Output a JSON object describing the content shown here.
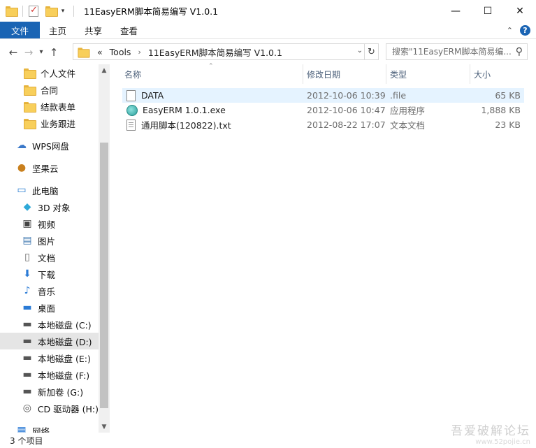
{
  "window": {
    "title": "11EasyERM脚本简易编写 V1.0.1",
    "minimize": "—",
    "maximize": "☐",
    "close": "✕"
  },
  "ribbon": {
    "tabs": [
      "文件",
      "主页",
      "共享",
      "查看"
    ],
    "collapse_icon": "chevron-up-icon",
    "help": "?"
  },
  "address": {
    "overflow": "«",
    "crumbs": [
      "Tools",
      "11EasyERM脚本简易编写 V1.0.1"
    ],
    "search_placeholder": "搜索\"11EasyERM脚本简易编..."
  },
  "nav": {
    "items": [
      {
        "label": "个人文件",
        "icon": "folder-icon"
      },
      {
        "label": "合同",
        "icon": "folder-icon"
      },
      {
        "label": "结款表单",
        "icon": "folder-icon"
      },
      {
        "label": "业务跟进",
        "icon": "folder-icon"
      },
      {
        "label": "WPS网盘",
        "icon": "cloud-icon"
      },
      {
        "label": "坚果云",
        "icon": "nut-icon"
      },
      {
        "label": "此电脑",
        "icon": "computer-icon"
      },
      {
        "label": "3D 对象",
        "icon": "cube-icon"
      },
      {
        "label": "视频",
        "icon": "video-icon"
      },
      {
        "label": "图片",
        "icon": "picture-icon"
      },
      {
        "label": "文档",
        "icon": "document-icon"
      },
      {
        "label": "下载",
        "icon": "download-icon"
      },
      {
        "label": "音乐",
        "icon": "music-icon"
      },
      {
        "label": "桌面",
        "icon": "desktop-icon"
      },
      {
        "label": "本地磁盘 (C:)",
        "icon": "drive-icon"
      },
      {
        "label": "本地磁盘 (D:)",
        "icon": "drive-icon"
      },
      {
        "label": "本地磁盘 (E:)",
        "icon": "drive-icon"
      },
      {
        "label": "本地磁盘 (F:)",
        "icon": "drive-icon"
      },
      {
        "label": "新加卷 (G:)",
        "icon": "drive-icon"
      },
      {
        "label": "CD 驱动器 (H:)",
        "icon": "cd-drive-icon"
      },
      {
        "label": "网络",
        "icon": "network-icon"
      }
    ],
    "selected": "本地磁盘 (D:)"
  },
  "columns": {
    "name": "名称",
    "date": "修改日期",
    "type": "类型",
    "size": "大小"
  },
  "files": [
    {
      "name": "DATA",
      "date": "2012-10-06 10:39",
      "type": ".file",
      "size": "65 KB",
      "icon": "file-icon"
    },
    {
      "name": "EasyERM 1.0.1.exe",
      "date": "2012-10-06 10:47",
      "type": "应用程序",
      "size": "1,888 KB",
      "icon": "exe-icon"
    },
    {
      "name": "通用脚本(120822).txt",
      "date": "2012-08-22 17:07",
      "type": "文本文档",
      "size": "23 KB",
      "icon": "text-file-icon"
    }
  ],
  "status": {
    "count": "3 个项目"
  },
  "watermark": {
    "line1": "吾爱破解论坛",
    "line2": "www.52pojie.cn"
  }
}
